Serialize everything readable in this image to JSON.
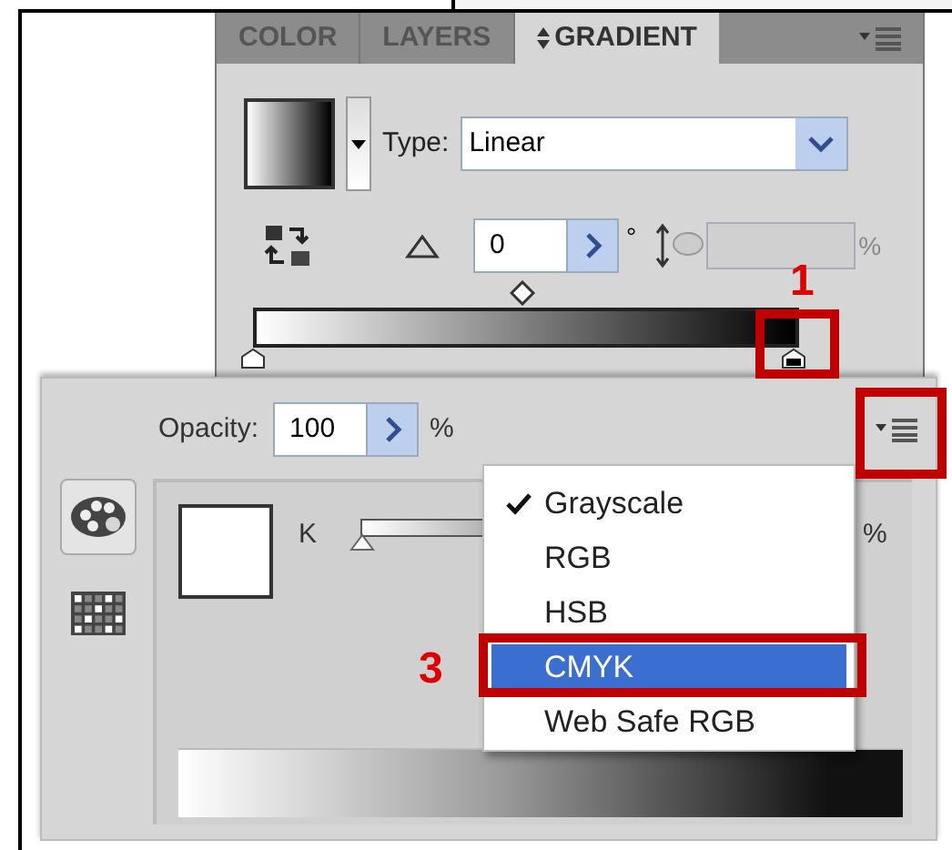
{
  "gradient_panel": {
    "tabs": [
      {
        "label": "COLOR",
        "selected": false
      },
      {
        "label": "LAYERS",
        "selected": false
      },
      {
        "label": "GRADIENT",
        "selected": true
      }
    ],
    "type_label": "Type:",
    "type_value": "Linear",
    "angle_value": "0",
    "degree_symbol": "°",
    "aspect_unit": "%"
  },
  "color_panel": {
    "opacity_label": "Opacity:",
    "opacity_value": "100",
    "opacity_unit": "%",
    "channel": {
      "label": "K",
      "level": 0,
      "unit": "%"
    }
  },
  "menu": {
    "items": [
      {
        "label": "Grayscale",
        "checked": true,
        "selected": false
      },
      {
        "label": "RGB",
        "checked": false,
        "selected": false
      },
      {
        "label": "HSB",
        "checked": false,
        "selected": false
      },
      {
        "label": "CMYK",
        "checked": false,
        "selected": true
      },
      {
        "label": "Web Safe RGB",
        "checked": false,
        "selected": false
      }
    ]
  },
  "annotations": [
    {
      "label": "1"
    },
    {
      "label": "3"
    }
  ]
}
